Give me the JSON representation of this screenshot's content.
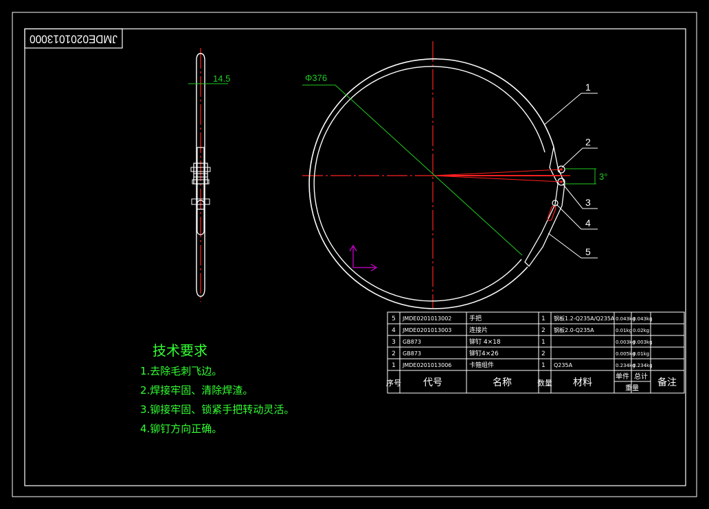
{
  "drawing": {
    "title_code": "JMDE0201013000",
    "colors": {
      "outline": "#ffffff",
      "centerline": "#ff2020",
      "dimension": "#22cc22",
      "notes": "#33ff33",
      "ucs": "#d000d0"
    },
    "dimensions": {
      "thickness": "14.5",
      "diameter": "Φ376",
      "angle": "3°"
    },
    "balloons": [
      "1",
      "2",
      "3",
      "4",
      "5"
    ],
    "tech_notes": {
      "title": "技术要求",
      "items": [
        "1.去除毛刺飞边。",
        "2.焊接牢固、清除焊渣。",
        "3.铆接牢固、锁紧手把转动灵活。",
        "4.铆钉方向正确。"
      ]
    },
    "bom": {
      "rows": [
        {
          "no": "5",
          "code": "JMDE0201013002",
          "name": "手把",
          "qty": "1",
          "material": "钢板1.2-Q235A/Q235A",
          "unit_wt": "0.043kg",
          "total_wt": "0.043kg",
          "remark": ""
        },
        {
          "no": "4",
          "code": "JMDE0201013003",
          "name": "连接片",
          "qty": "2",
          "material": "钢板2.0-Q235A",
          "unit_wt": "0.01kg",
          "total_wt": "0.02kg",
          "remark": ""
        },
        {
          "no": "3",
          "code": "GB873",
          "name": "铆钉 4×18",
          "qty": "1",
          "material": "",
          "unit_wt": "0.003kg",
          "total_wt": "0.003kg",
          "remark": ""
        },
        {
          "no": "2",
          "code": "GB873",
          "name": "铆钉4×26",
          "qty": "2",
          "material": "",
          "unit_wt": "0.005kg",
          "total_wt": "0.01kg",
          "remark": ""
        },
        {
          "no": "1",
          "code": "JMDE0201013006",
          "name": "卡箍组件",
          "qty": "1",
          "material": "Q235A",
          "unit_wt": "0.234kg",
          "total_wt": "0.234kg",
          "remark": ""
        }
      ],
      "header": {
        "no": "序号",
        "code": "代号",
        "name": "名称",
        "qty": "数量",
        "material": "材料",
        "unit": "单件",
        "total": "总计",
        "weight": "重量",
        "remark": "备注"
      }
    }
  }
}
